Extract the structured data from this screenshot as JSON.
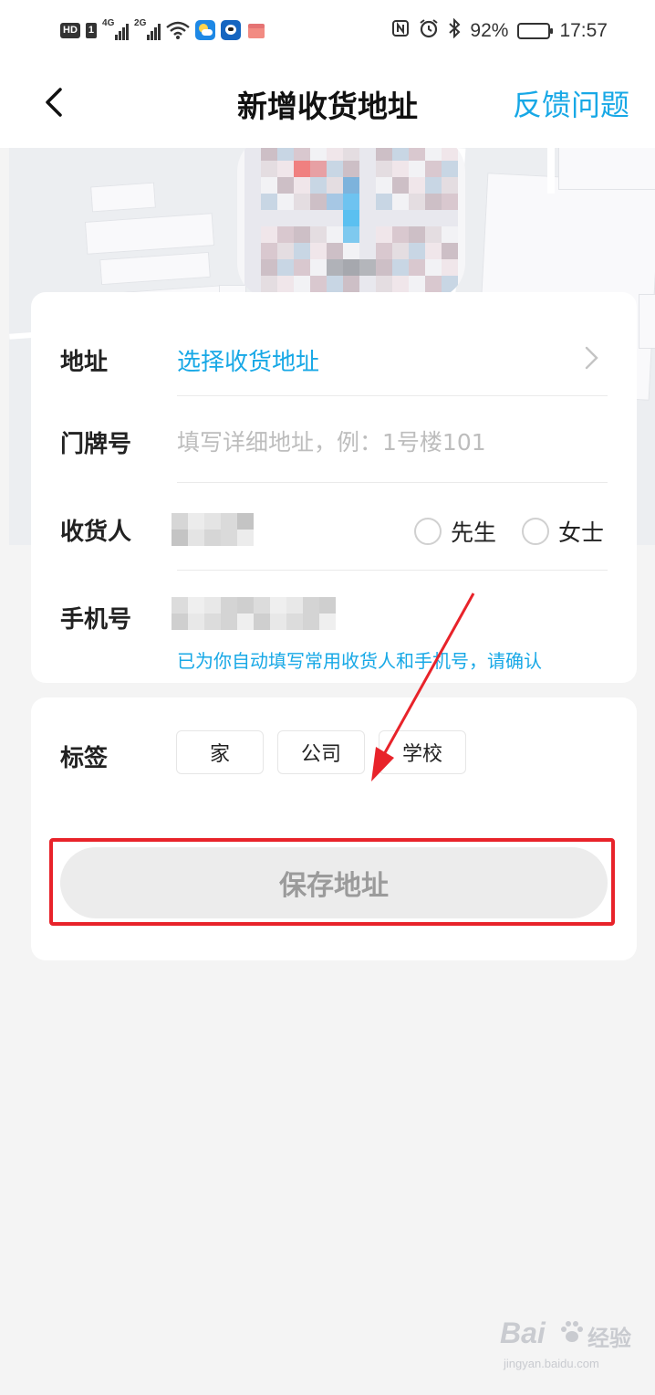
{
  "status_bar": {
    "hd": "HD",
    "sim": "1",
    "net1": "4G",
    "net2": "2G",
    "battery_text": "92%",
    "battery_level": 0.92,
    "time": "17:57",
    "nfc_icon": "nfc-icon",
    "alarm_icon": "alarm-icon",
    "bluetooth_icon": "bluetooth-icon"
  },
  "nav": {
    "title": "新增收货地址",
    "feedback": "反馈问题",
    "back_icon": "back-arrow-icon"
  },
  "form": {
    "address_label": "地址",
    "address_link": "选择收货地址",
    "door_label": "门牌号",
    "door_placeholder": "填写详细地址，例：1号楼101",
    "door_value": "",
    "receiver_label": "收货人",
    "salutation_options": [
      "先生",
      "女士"
    ],
    "phone_label": "手机号",
    "auto_fill_hint": "已为你自动填写常用收货人和手机号，请确认"
  },
  "tags": {
    "label": "标签",
    "options": [
      "家",
      "公司",
      "学校"
    ]
  },
  "save_button": "保存地址",
  "watermark": {
    "main": "Bai",
    "sub": "jingyan.baidu.com",
    "suffix": "经验"
  },
  "colors": {
    "accent": "#17a8e6",
    "annotation": "#e8232a",
    "background": "#f4f4f4",
    "button_disabled": "#ececec"
  }
}
